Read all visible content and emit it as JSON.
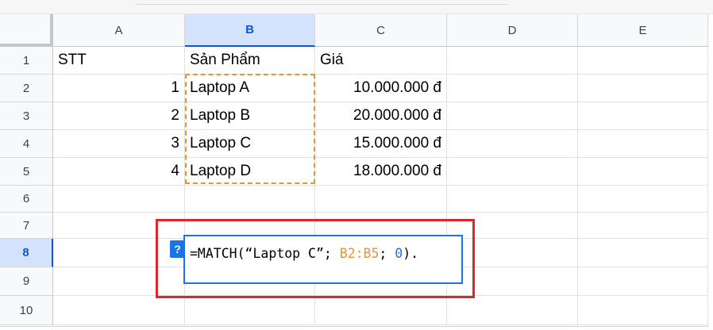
{
  "columns": [
    "A",
    "B",
    "C",
    "D",
    "E"
  ],
  "rows": [
    "1",
    "2",
    "3",
    "4",
    "5",
    "6",
    "7",
    "8",
    "9",
    "10"
  ],
  "cells": {
    "A1": "STT",
    "B1": "Sản Phẩm",
    "C1": "Giá",
    "A2": "1",
    "B2": "Laptop A",
    "C2": "10.000.000 đ",
    "A3": "2",
    "B3": "Laptop B",
    "C3": "20.000.000 đ",
    "A4": "3",
    "B4": "Laptop C",
    "C4": "15.000.000 đ",
    "A5": "4",
    "B5": "Laptop D",
    "C5": "18.000.000 đ"
  },
  "selection": {
    "column": "B",
    "row": "8"
  },
  "formula": {
    "prefix": "=MATCH(“Laptop C”; ",
    "range": "B2:B5",
    "sep": "; ",
    "match_type": "0",
    "suffix": ")."
  },
  "help_icon": "?",
  "colors": {
    "range_highlight": "#e8962c",
    "selection_blue": "#1a73e8",
    "annotation_red": "#e0262a"
  }
}
